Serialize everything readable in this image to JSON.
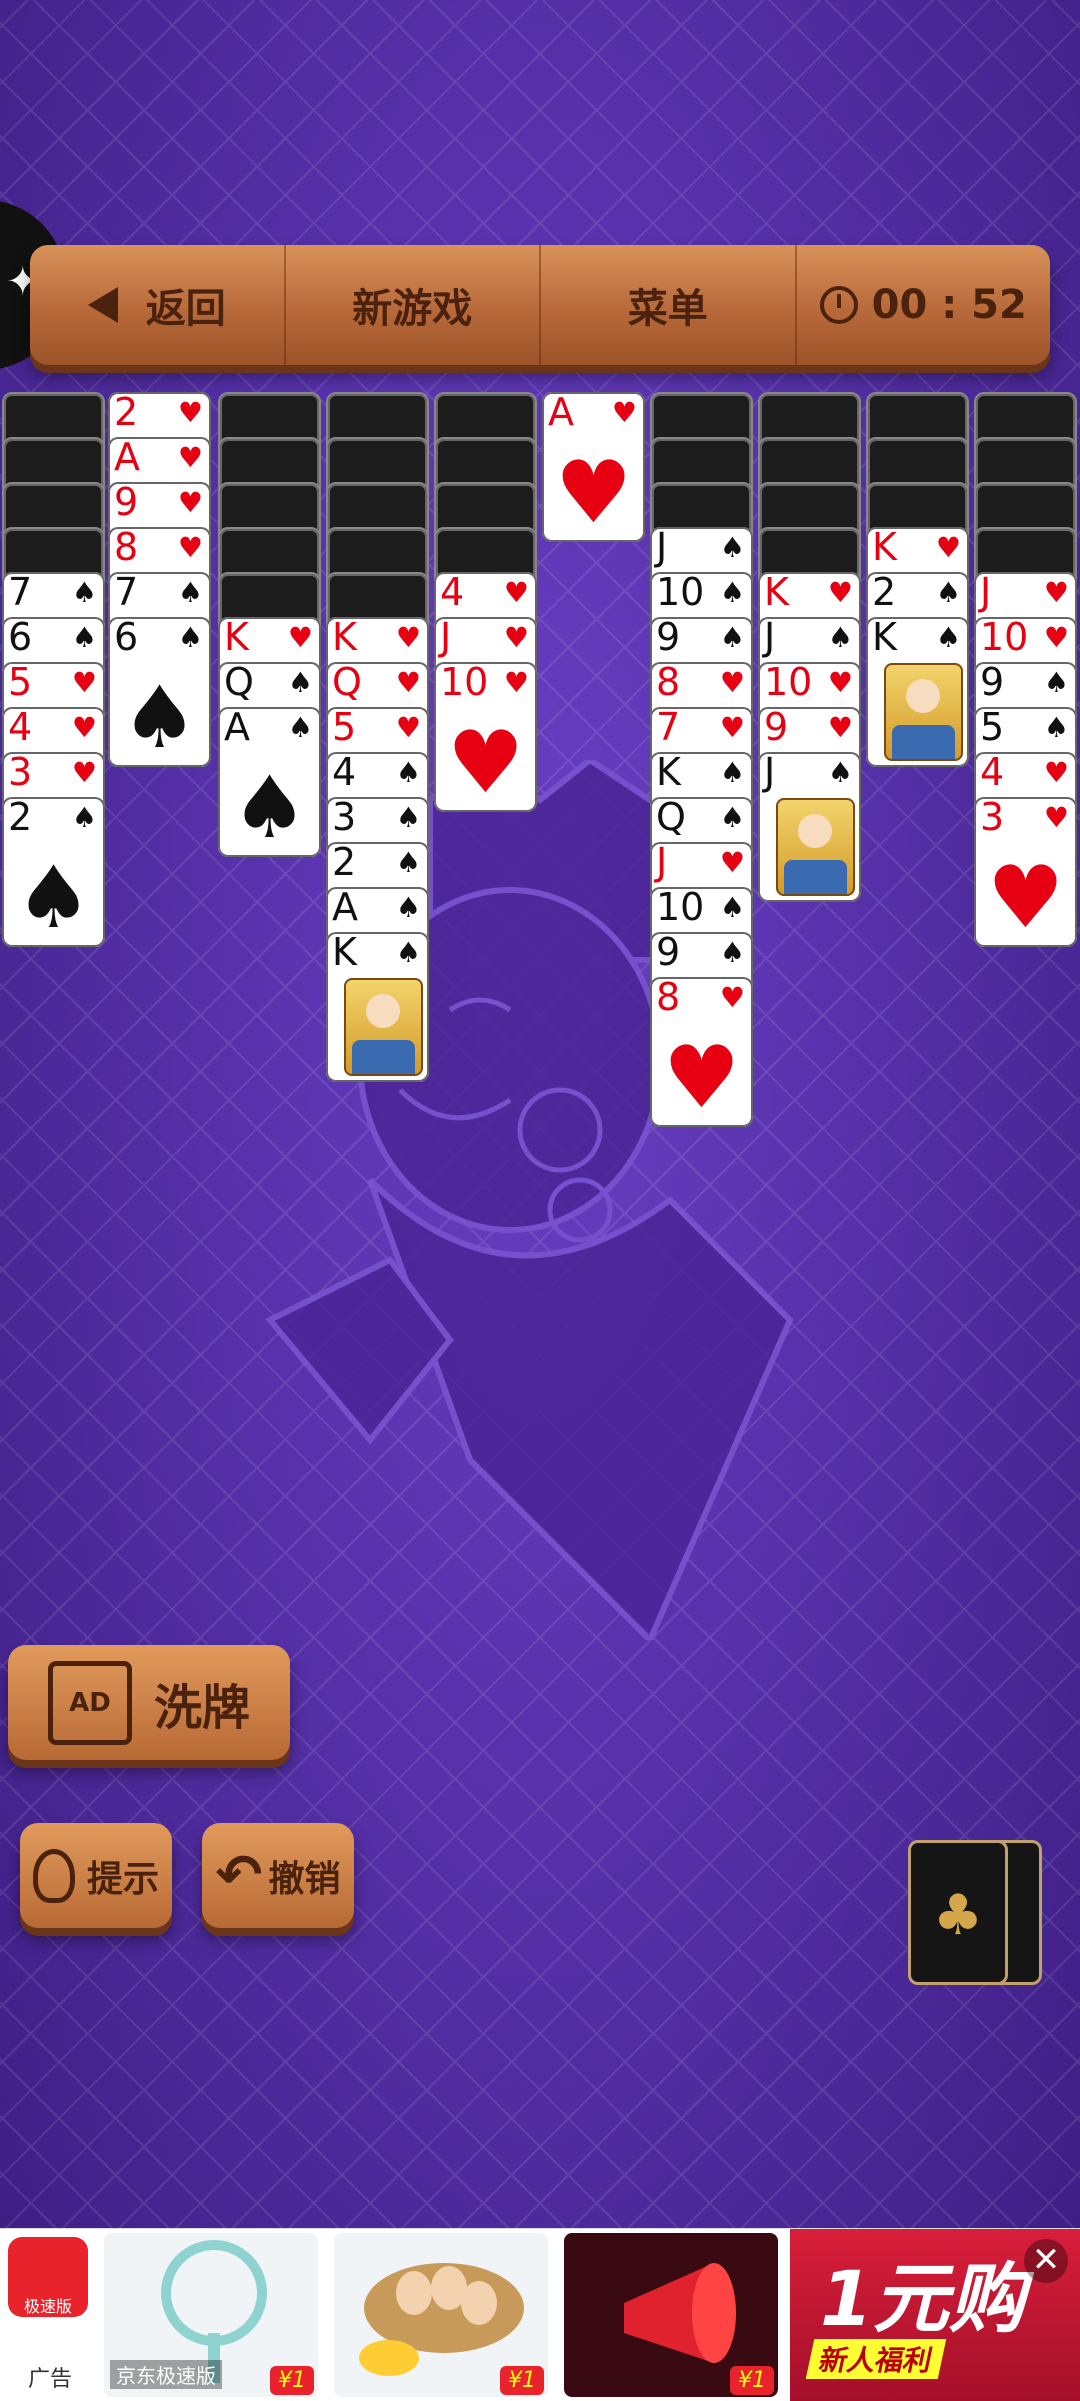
{
  "topbar": {
    "back_label": "返回",
    "new_game_label": "新游戏",
    "menu_label": "菜单",
    "timer": "00 : 52"
  },
  "columns": [
    {
      "backs": 4,
      "cards": [
        [
          "7",
          "♠",
          "black"
        ],
        [
          "6",
          "♠",
          "black"
        ],
        [
          "5",
          "♥",
          "red"
        ],
        [
          "4",
          "♥",
          "red"
        ],
        [
          "3",
          "♥",
          "red"
        ],
        [
          "2",
          "♠",
          "black"
        ]
      ]
    },
    {
      "backs": 0,
      "cards": [
        [
          "2",
          "♥",
          "red"
        ],
        [
          "A",
          "♥",
          "red"
        ],
        [
          "9",
          "♥",
          "red"
        ],
        [
          "8",
          "♥",
          "red"
        ],
        [
          "7",
          "♠",
          "black"
        ],
        [
          "6",
          "♠",
          "black"
        ]
      ]
    },
    {
      "backs": 5,
      "cards": [
        [
          "K",
          "♥",
          "red"
        ],
        [
          "Q",
          "♠",
          "black"
        ],
        [
          "A",
          "♠",
          "black"
        ]
      ]
    },
    {
      "backs": 5,
      "cards": [
        [
          "K",
          "♥",
          "red"
        ],
        [
          "Q",
          "♥",
          "red"
        ],
        [
          "5",
          "♥",
          "red"
        ],
        [
          "4",
          "♠",
          "black"
        ],
        [
          "3",
          "♠",
          "black"
        ],
        [
          "2",
          "♠",
          "black"
        ],
        [
          "A",
          "♠",
          "black"
        ],
        [
          "K",
          "♠",
          "black"
        ]
      ]
    },
    {
      "backs": 4,
      "cards": [
        [
          "4",
          "♥",
          "red"
        ],
        [
          "J",
          "♥",
          "red"
        ],
        [
          "10",
          "♥",
          "red"
        ]
      ]
    },
    {
      "backs": 0,
      "cards": [
        [
          "A",
          "♥",
          "red"
        ]
      ]
    },
    {
      "backs": 3,
      "cards": [
        [
          "J",
          "♠",
          "black"
        ],
        [
          "10",
          "♠",
          "black"
        ],
        [
          "9",
          "♠",
          "black"
        ],
        [
          "8",
          "♥",
          "red"
        ],
        [
          "7",
          "♥",
          "red"
        ],
        [
          "K",
          "♠",
          "black"
        ],
        [
          "Q",
          "♠",
          "black"
        ],
        [
          "J",
          "♥",
          "red"
        ],
        [
          "10",
          "♠",
          "black"
        ],
        [
          "9",
          "♠",
          "black"
        ],
        [
          "8",
          "♥",
          "red"
        ]
      ]
    },
    {
      "backs": 4,
      "cards": [
        [
          "K",
          "♥",
          "red"
        ],
        [
          "J",
          "♠",
          "black"
        ],
        [
          "10",
          "♥",
          "red"
        ],
        [
          "9",
          "♥",
          "red"
        ],
        [
          "J",
          "♠",
          "black"
        ]
      ]
    },
    {
      "backs": 3,
      "cards": [
        [
          "K",
          "♥",
          "red"
        ],
        [
          "2",
          "♠",
          "black"
        ],
        [
          "K",
          "♠",
          "black"
        ]
      ]
    },
    {
      "backs": 4,
      "cards": [
        [
          "J",
          "♥",
          "red"
        ],
        [
          "10",
          "♥",
          "red"
        ],
        [
          "9",
          "♠",
          "black"
        ],
        [
          "5",
          "♠",
          "black"
        ],
        [
          "4",
          "♥",
          "red"
        ],
        [
          "3",
          "♥",
          "red"
        ]
      ]
    }
  ],
  "buttons": {
    "shuffle_label": "洗牌",
    "shuffle_ad_text": "AD",
    "hint_label": "提示",
    "undo_label": "撤销"
  },
  "stock": {
    "suit": "♣"
  },
  "ad": {
    "logo_text": "极速版",
    "ad_tag": "广告",
    "brand": "京东极速版",
    "price_tag": "¥1",
    "promo_big": "1元购",
    "promo_sub": "新人福利",
    "close": "✕"
  },
  "colors": {
    "red": "#e60012",
    "black": "#111111",
    "felt": "#5530a8",
    "wood": "#b8693a"
  }
}
